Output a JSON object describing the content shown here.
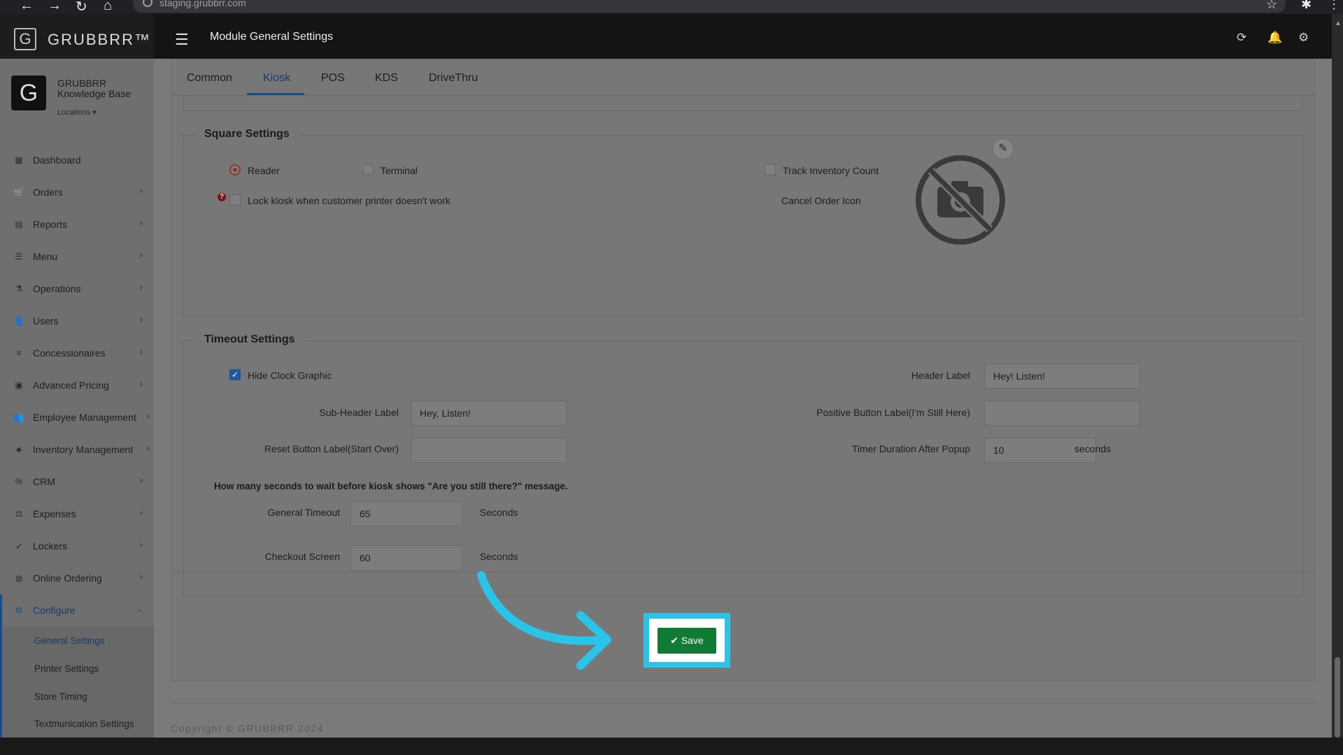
{
  "browser": {
    "url": "staging.grubbrr.com"
  },
  "app": {
    "brand": "GRUBBRR™",
    "logo_letter": "G",
    "page_title": "Module General Settings"
  },
  "profile": {
    "letter": "G",
    "name": "GRUBBRR Knowledge Base",
    "locations_label": "Locations ▾"
  },
  "sidebar": {
    "items": [
      {
        "label": "Dashboard",
        "icon": "dashboard-icon"
      },
      {
        "label": "Orders",
        "icon": "cart-icon"
      },
      {
        "label": "Reports",
        "icon": "file-icon"
      },
      {
        "label": "Menu",
        "icon": "menu-icon"
      },
      {
        "label": "Operations",
        "icon": "flask-icon"
      },
      {
        "label": "Users",
        "icon": "user-add-icon"
      },
      {
        "label": "Concessionaires",
        "icon": "list-icon"
      },
      {
        "label": "Advanced Pricing",
        "icon": "money-icon"
      },
      {
        "label": "Employee Management",
        "icon": "users-icon"
      },
      {
        "label": "Inventory Management",
        "icon": "sitemap-icon"
      },
      {
        "label": "CRM",
        "icon": "percent-icon"
      },
      {
        "label": "Expenses",
        "icon": "scale-icon"
      },
      {
        "label": "Lockers",
        "icon": "rocket-icon"
      },
      {
        "label": "Online Ordering",
        "icon": "globe-icon"
      },
      {
        "label": "Configure",
        "icon": "gear-icon"
      }
    ],
    "submenu": [
      "General Settings",
      "Printer Settings",
      "Store Timing",
      "Textmunication Settings"
    ]
  },
  "tabs": [
    "Common",
    "Kiosk",
    "POS",
    "KDS",
    "DriveThru"
  ],
  "active_tab": "Kiosk",
  "square": {
    "title": "Square Settings",
    "reader_label": "Reader",
    "terminal_label": "Terminal",
    "track_inventory_label": "Track Inventory Count",
    "lock_kiosk_label": "Lock kiosk when customer printer doesn't work",
    "cancel_order_icon_label": "Cancel Order Icon"
  },
  "timeout": {
    "title": "Timeout Settings",
    "hide_clock_label": "Hide Clock Graphic",
    "header_label": "Header Label",
    "header_value": "Hey! Listen!",
    "subheader_label": "Sub-Header Label",
    "subheader_value": "Hey, Listen!",
    "positive_label": "Positive Button Label(I'm Still Here)",
    "positive_value": "",
    "reset_label": "Reset Button Label(Start Over)",
    "reset_value": "",
    "timer_label": "Timer Duration After Popup",
    "timer_value": "10",
    "timer_unit": "seconds",
    "note": "How many seconds to wait before kiosk shows \"Are you still there?\" message.",
    "general_label": "General Timeout",
    "general_value": "65",
    "checkout_label": "Checkout Screen",
    "checkout_value": "60",
    "unit": "Seconds"
  },
  "save_label": "Save",
  "copyright": "Copyright © GRUBBRR 2024",
  "colors": {
    "highlight": "#29c4e8",
    "save": "#117a34",
    "accent": "#1a4e8a"
  }
}
